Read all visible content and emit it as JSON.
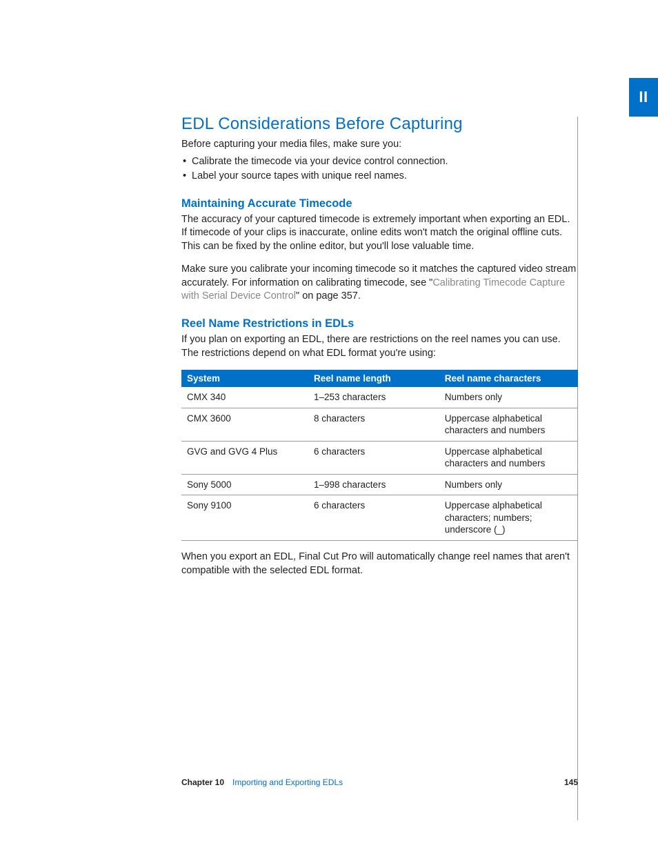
{
  "partTab": "II",
  "title": "EDL Considerations Before Capturing",
  "intro": "Before capturing your media files, make sure you:",
  "bullets": [
    "Calibrate the timecode via your device control connection.",
    "Label your source tapes with unique reel names."
  ],
  "sec1": {
    "heading": "Maintaining Accurate Timecode",
    "p1": "The accuracy of your captured timecode is extremely important when exporting an EDL. If timecode of your clips is inaccurate, online edits won't match the original offline cuts. This can be fixed by the online editor, but you'll lose valuable time.",
    "p2_a": "Make sure you calibrate your incoming timecode so it matches the captured video stream accurately. For information on calibrating timecode, see \"",
    "p2_xref": "Calibrating Timecode Capture with Serial Device Control",
    "p2_b": "\" on page 357."
  },
  "sec2": {
    "heading": "Reel Name Restrictions in EDLs",
    "p1": "If you plan on exporting an EDL, there are restrictions on the reel names you can use. The restrictions depend on what EDL format you're using:",
    "p2": "When you export an EDL, Final Cut Pro will automatically change reel names that aren't compatible with the selected EDL format."
  },
  "table": {
    "headers": [
      "System",
      "Reel name length",
      "Reel name characters"
    ],
    "rows": [
      [
        "CMX 340",
        "1–253 characters",
        "Numbers only"
      ],
      [
        "CMX 3600",
        "8 characters",
        "Uppercase alphabetical characters and numbers"
      ],
      [
        "GVG and GVG 4 Plus",
        "6 characters",
        "Uppercase alphabetical characters and numbers"
      ],
      [
        "Sony 5000",
        "1–998 characters",
        "Numbers only"
      ],
      [
        "Sony 9100",
        "6 characters",
        "Uppercase alphabetical characters; numbers; underscore (_)"
      ]
    ]
  },
  "footer": {
    "chapterLabel": "Chapter 10",
    "chapterTitle": "Importing and Exporting EDLs",
    "pageNumber": "145"
  }
}
